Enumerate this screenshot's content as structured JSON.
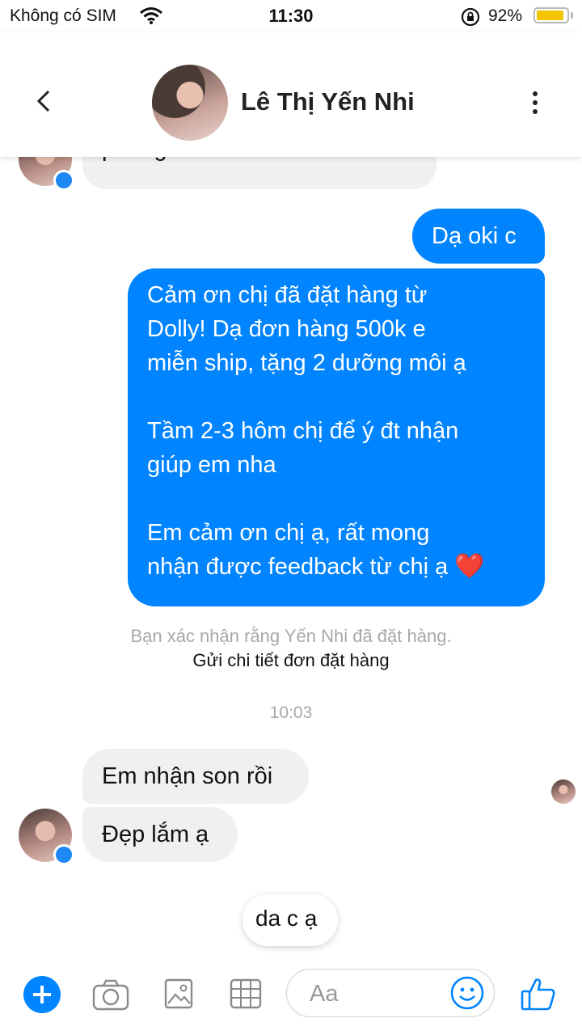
{
  "status_bar": {
    "carrier": "Không có SIM",
    "time": "11:30",
    "battery_percent": "92%",
    "battery_level": 0.92
  },
  "header": {
    "contact_name": "Lê Thị Yến Nhi"
  },
  "messages": {
    "m0": {
      "text": "phong"
    },
    "m1": {
      "text": "Dạ oki c"
    },
    "m2": {
      "lines": [
        "Cảm ơn chị đã đặt hàng từ",
        "Dolly!  Dạ đơn hàng 500k e",
        "miễn ship, tặng 2 dưỡng môi ạ",
        "",
        "Tầm 2-3  hôm chị để ý đt nhận",
        "giúp em nha",
        "",
        "Em cảm ơn chị ạ, rất mong",
        "nhận được feedback từ chị ạ"
      ],
      "emoji": "❤️"
    },
    "system": {
      "notice": "Bạn xác nhận rằng Yến Nhi đã đặt hàng.",
      "action": "Gửi chi tiết đơn đặt hàng"
    },
    "timestamp": "10:03",
    "m3": {
      "text": "Em nhận son rồi"
    },
    "m4": {
      "text": "Đẹp lắm ạ"
    },
    "m5": {
      "text": "da c ạ"
    }
  },
  "composer": {
    "placeholder": "Aa"
  },
  "colors": {
    "accent": "#0084ff",
    "incoming_bubble": "#f0f0f0",
    "battery": "#f5c400"
  },
  "icons": [
    "wifi-icon",
    "lock-rotation-icon",
    "battery-icon",
    "back-chevron-icon",
    "more-vertical-icon",
    "messenger-badge-icon",
    "plus-icon",
    "camera-icon",
    "image-icon",
    "grid-icon",
    "emoji-icon",
    "thumbs-up-icon"
  ]
}
